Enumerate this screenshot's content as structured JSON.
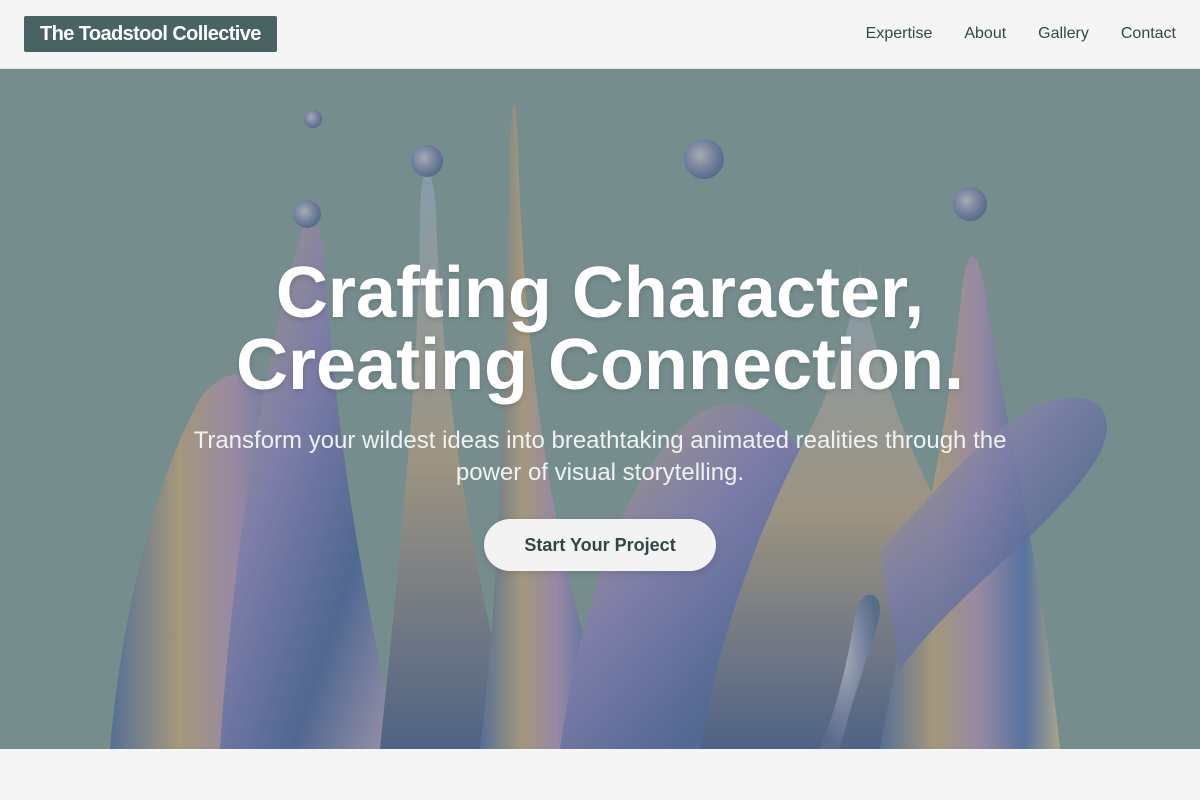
{
  "brand": {
    "name": "The Toadstool Collective"
  },
  "nav": {
    "items": [
      {
        "label": "Expertise"
      },
      {
        "label": "About"
      },
      {
        "label": "Gallery"
      },
      {
        "label": "Contact"
      }
    ]
  },
  "hero": {
    "title": "Crafting Character, Creating Connection.",
    "subtitle": "Transform your wildest ideas into breathtaking animated realities through the power of visual storytelling.",
    "cta_label": "Start Your Project",
    "image_icon": "iridescent-liquid-splash-image"
  },
  "colors": {
    "brand": "#476463",
    "nav_text": "#2f4a48",
    "hero_overlay": "#6e8a88",
    "cta_bg": "#f3f3f3",
    "cta_text": "#2e4847",
    "page_bg": "#f5f5f5"
  }
}
